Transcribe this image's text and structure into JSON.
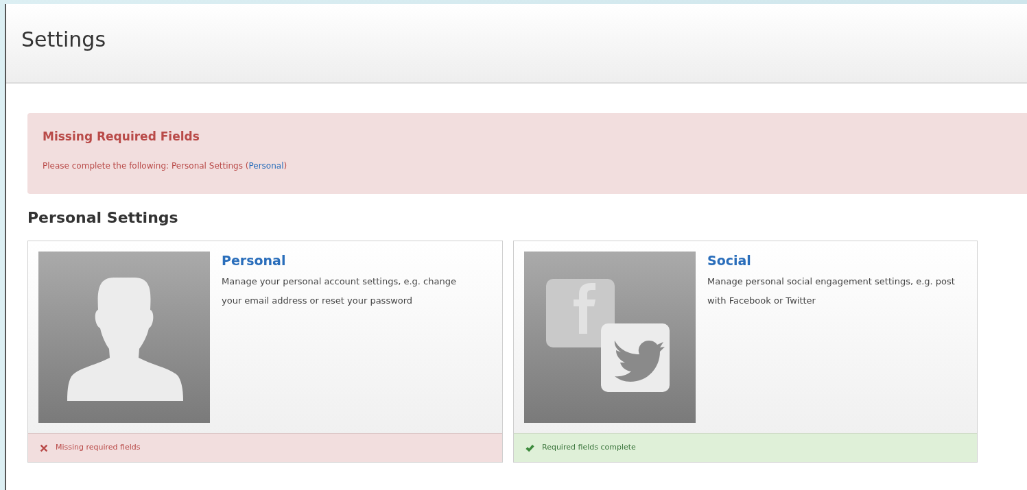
{
  "header": {
    "title": "Settings"
  },
  "alert": {
    "title": "Missing Required Fields",
    "message_prefix": "Please complete the following: Personal Settings (",
    "link": "Personal",
    "message_suffix": ")"
  },
  "section": {
    "title": "Personal Settings"
  },
  "cards": [
    {
      "kind": "personal",
      "title": "Personal",
      "description": "Manage your personal account settings, e.g. change your email address or reset your password",
      "complete": false,
      "status": "Missing required fields"
    },
    {
      "kind": "social",
      "title": "Social",
      "description": "Manage personal social engagement settings, e.g. post with Facebook or Twitter",
      "complete": true,
      "status": "Required fields complete"
    }
  ]
}
